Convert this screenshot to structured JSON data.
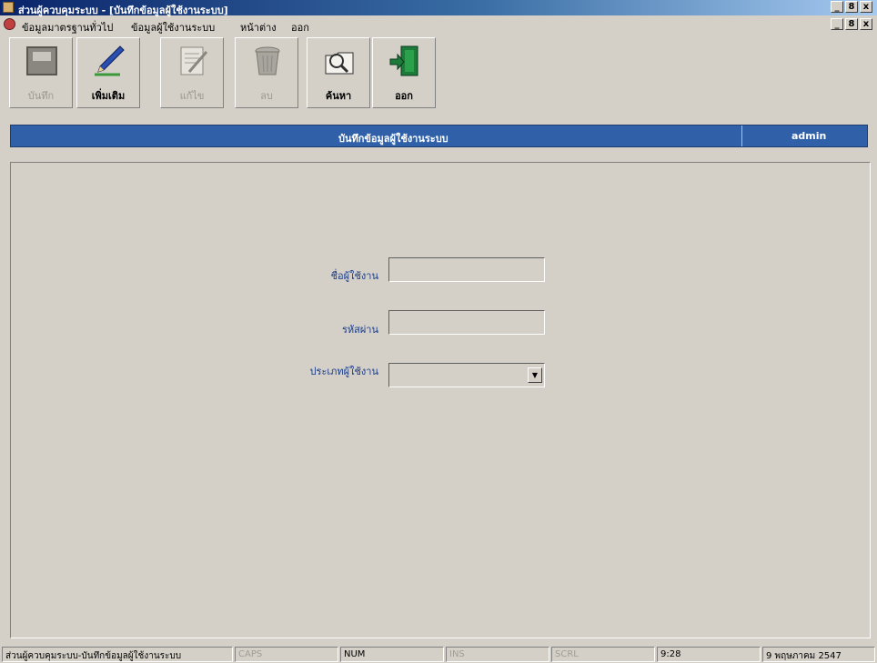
{
  "window": {
    "title": "ส่วนผู้ควบคุมระบบ - [บันทึกข้อมูลผู้ใช้งานระบบ]",
    "controls": [
      "_",
      "8",
      "x"
    ]
  },
  "menu": {
    "items": [
      "ข้อมูลมาตรฐานทั่วไป",
      "ข้อมูลผู้ใช้งานระบบ",
      "หน้าต่าง",
      "ออก"
    ]
  },
  "toolbar": {
    "buttons": [
      {
        "label": "บันทึก",
        "icon": "save-icon",
        "enabled": false
      },
      {
        "label": "เพิ่มเติม",
        "icon": "add-pen-icon",
        "enabled": true
      },
      {
        "label": "แก้ไข",
        "icon": "edit-icon",
        "enabled": false
      },
      {
        "label": "ลบ",
        "icon": "trash-icon",
        "enabled": false
      },
      {
        "label": "ค้นหา",
        "icon": "search-folder-icon",
        "enabled": true
      },
      {
        "label": "ออก",
        "icon": "exit-door-icon",
        "enabled": true
      }
    ]
  },
  "header": {
    "title": "บันทึกข้อมูลผู้ใช้งานระบบ",
    "user": "admin"
  },
  "form": {
    "username_label": "ชื่อผู้ใช้งาน",
    "username_value": "",
    "password_label": "รหัสผ่าน",
    "password_value": "",
    "usertype_label": "ประเภทผู้ใช้งาน",
    "usertype_value": ""
  },
  "status": {
    "text": "ส่วนผู้ควบคุมระบบ-บันทึกข้อมูลผู้ใช้งานระบบ",
    "caps": "CAPS",
    "num": "NUM",
    "ins": "INS",
    "scrl": "SCRL",
    "time": "9:28",
    "date": "9 พฤษภาคม 2547"
  },
  "colors": {
    "window_bg": "#d4d0c8",
    "header_bg": "#2f60a8",
    "label_text": "#1a3d8a"
  }
}
